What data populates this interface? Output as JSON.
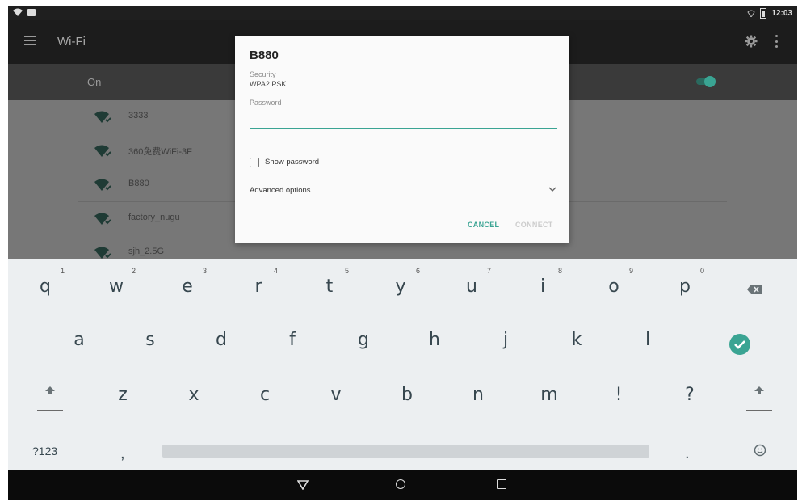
{
  "status_bar": {
    "time": "12:03"
  },
  "toolbar": {
    "title": "Wi-Fi"
  },
  "wifi_switch": {
    "label": "On",
    "enabled": true
  },
  "networks": [
    {
      "name": "3333"
    },
    {
      "name": "360免费WiFi-3F"
    },
    {
      "name": "B880"
    },
    {
      "name": "factory_nugu"
    },
    {
      "name": "sjh_2.5G"
    }
  ],
  "dialog": {
    "title": "B880",
    "security_label": "Security",
    "security_value": "WPA2 PSK",
    "password_label": "Password",
    "password_value": "",
    "show_password_label": "Show password",
    "show_password_checked": false,
    "advanced_label": "Advanced options",
    "cancel_label": "CANCEL",
    "connect_label": "CONNECT"
  },
  "keyboard": {
    "row1": [
      {
        "k": "q",
        "h": "1"
      },
      {
        "k": "w",
        "h": "2"
      },
      {
        "k": "e",
        "h": "3"
      },
      {
        "k": "r",
        "h": "4"
      },
      {
        "k": "t",
        "h": "5"
      },
      {
        "k": "y",
        "h": "6"
      },
      {
        "k": "u",
        "h": "7"
      },
      {
        "k": "i",
        "h": "8"
      },
      {
        "k": "o",
        "h": "9"
      },
      {
        "k": "p",
        "h": "0"
      }
    ],
    "row2": [
      "a",
      "s",
      "d",
      "f",
      "g",
      "h",
      "j",
      "k",
      "l"
    ],
    "row3": [
      "z",
      "x",
      "c",
      "v",
      "b",
      "n",
      "m",
      "!",
      "?"
    ],
    "symbols_label": "?123",
    "comma": ",",
    "period": "."
  },
  "colors": {
    "accent": "#3aa493",
    "toolbar": "#1c1c1c",
    "keyboard_bg": "#eceff1"
  }
}
